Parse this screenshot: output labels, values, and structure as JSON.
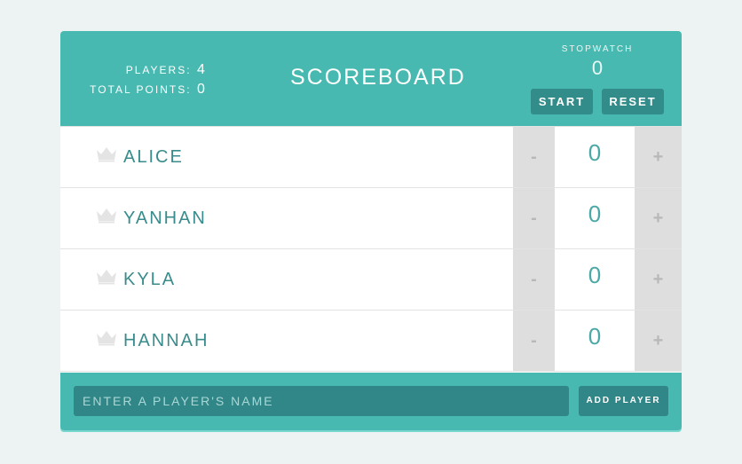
{
  "header": {
    "title": "SCOREBOARD",
    "players_label": "PLAYERS:",
    "players_value": "4",
    "total_points_label": "TOTAL POINTS:",
    "total_points_value": "0"
  },
  "stopwatch": {
    "label": "STOPWATCH",
    "time": "0",
    "start_label": "START",
    "reset_label": "RESET"
  },
  "players": [
    {
      "name": "ALICE",
      "score": "0",
      "minus": "-",
      "plus": "+"
    },
    {
      "name": "YANHAN",
      "score": "0",
      "minus": "-",
      "plus": "+"
    },
    {
      "name": "KYLA",
      "score": "0",
      "minus": "-",
      "plus": "+"
    },
    {
      "name": "HANNAH",
      "score": "0",
      "minus": "-",
      "plus": "+"
    }
  ],
  "footer": {
    "input_placeholder": "ENTER A PLAYER'S NAME",
    "input_value": "",
    "add_label": "ADD PLAYER"
  },
  "colors": {
    "header_bg": "#47b9b0",
    "button_bg": "#318c8a",
    "name_text": "#3a8c8c",
    "crown": "#e4e4e4"
  },
  "icons": {
    "player_icon": "crown-icon"
  }
}
